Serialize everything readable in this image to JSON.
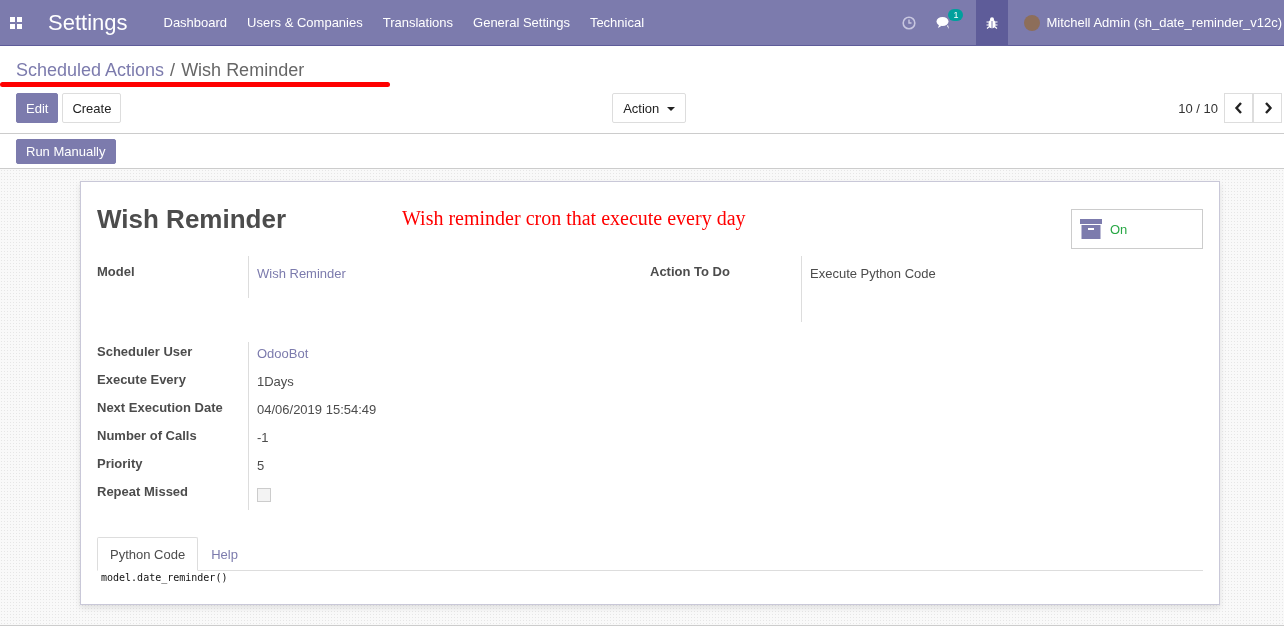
{
  "navbar": {
    "app_title": "Settings",
    "menu": [
      "Dashboard",
      "Users & Companies",
      "Translations",
      "General Settings",
      "Technical"
    ],
    "messages_badge": "1",
    "debug_active": true,
    "user": "Mitchell Admin (sh_date_reminder_v12c)"
  },
  "breadcrumb_separator": "/",
  "breadcrumb": [
    {
      "label": "Scheduled Actions",
      "kind": "link"
    },
    {
      "label": "Wish Reminder",
      "kind": "current"
    }
  ],
  "buttons": {
    "edit": "Edit",
    "create": "Create",
    "action": "Action",
    "run": "Run Manually"
  },
  "pager": "10 / 10",
  "record": {
    "title": "Wish Reminder",
    "note": "Wish reminder cron that execute every day",
    "active": true,
    "active_label": "On"
  },
  "left_top": [
    {
      "label": "Model",
      "value": "Wish Reminder",
      "kind": "link"
    }
  ],
  "right_top": [
    {
      "label": "Action To Do",
      "value": "Execute Python Code",
      "kind": "text"
    }
  ],
  "fields": [
    {
      "label": "Scheduler User",
      "value": "OdooBot",
      "kind": "link"
    },
    {
      "label": "Execute Every",
      "value": "1Days",
      "kind": "text"
    },
    {
      "label": "Next Execution Date",
      "value": "04/06/2019 15:54:49",
      "kind": "text"
    },
    {
      "label": "Number of Calls",
      "value": "-1",
      "kind": "text"
    },
    {
      "label": "Priority",
      "value": "5",
      "kind": "text"
    },
    {
      "label": "Repeat Missed",
      "kind": "checkbox",
      "checked": false
    }
  ],
  "tabs": [
    {
      "label": "Python Code",
      "selected": true
    },
    {
      "label": "Help",
      "selected": false
    }
  ],
  "code": "model.date_reminder()"
}
